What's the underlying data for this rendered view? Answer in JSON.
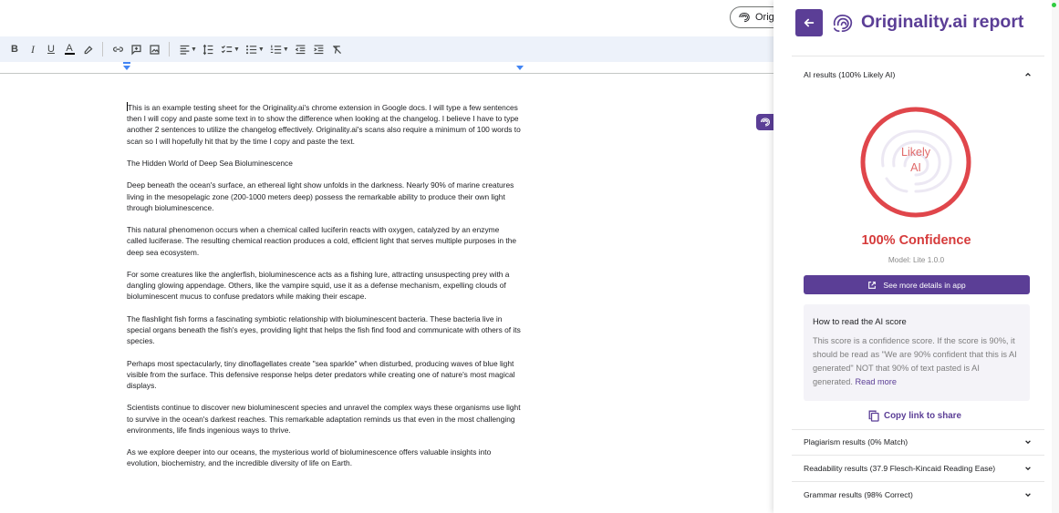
{
  "docs": {
    "extension_pill_label": "Origi",
    "toolbar": {
      "bold": "B",
      "italic": "I",
      "underline": "U",
      "text_color": "A"
    },
    "paragraphs": [
      "This is an example testing sheet for the Originality.ai's chrome extension in Google docs. I will type a few sentences then I will copy and paste some text in to show the difference when looking at the changelog. I believe I have to type another 2 sentences to utilize the changelog effectively. Originality.ai's scans also require a minimum of 100 words to scan so I will hopefully hit that by the time I copy and paste the text.",
      "The Hidden World of Deep Sea Bioluminescence",
      "Deep beneath the ocean's surface, an ethereal light show unfolds in the darkness. Nearly 90% of marine creatures living in the mesopelagic zone (200-1000 meters deep) possess the remarkable ability to produce their own light through bioluminescence.",
      "This natural phenomenon occurs when a chemical called luciferin reacts with oxygen, catalyzed by an enzyme called luciferase. The resulting chemical reaction produces a cold, efficient light that serves multiple purposes in the deep sea ecosystem.",
      "For some creatures like the anglerfish, bioluminescence acts as a fishing lure, attracting unsuspecting prey with a dangling glowing appendage. Others, like the vampire squid, use it as a defense mechanism, expelling clouds of bioluminescent mucus to confuse predators while making their escape.",
      "The flashlight fish forms a fascinating symbiotic relationship with bioluminescent bacteria. These bacteria live in special organs beneath the fish's eyes, providing light that helps the fish find food and communicate with others of its species.",
      "Perhaps most spectacularly, tiny dinoflagellates create \"sea sparkle\" when disturbed, producing waves of blue light visible from the surface. This defensive response helps deter predators while creating one of nature's most magical displays.",
      "Scientists continue to discover new bioluminescent species and unravel the complex ways these organisms use light to survive in the ocean's darkest reaches. This remarkable adaptation reminds us that even in the most challenging environments, life finds ingenious ways to thrive.",
      "As we explore deeper into our oceans, the mysterious world of bioluminescence offers valuable insights into evolution, biochemistry, and the incredible diversity of life on Earth."
    ]
  },
  "panel": {
    "title": "Originality.ai report",
    "ai_results_label": "AI results (100% Likely AI)",
    "gauge_line1": "Likely",
    "gauge_line2": "AI",
    "gauge_value": 1.0,
    "confidence_text": "100% Confidence",
    "model_text": "Model: Lite 1.0.0",
    "details_button": "See more details in app",
    "howto_title": "How to read the AI score",
    "howto_body": "This score is a confidence score. If the score is 90%, it should be read as \"We are 90% confident that this is AI generated\" NOT that 90% of text pasted is AI generated.",
    "howto_more": "Read more",
    "copy_link": "Copy link to share",
    "plagiarism_label": "Plagiarism results (0% Match)",
    "readability_label": "Readability results (37.9 Flesch-Kincaid Reading Ease)",
    "grammar_label": "Grammar results (98% Correct)"
  },
  "colors": {
    "brand_purple": "#5b3e96",
    "gauge_red": "#e0464b",
    "confidence_red": "#d63b3b",
    "toolbar_bg": "#edf2fa"
  }
}
